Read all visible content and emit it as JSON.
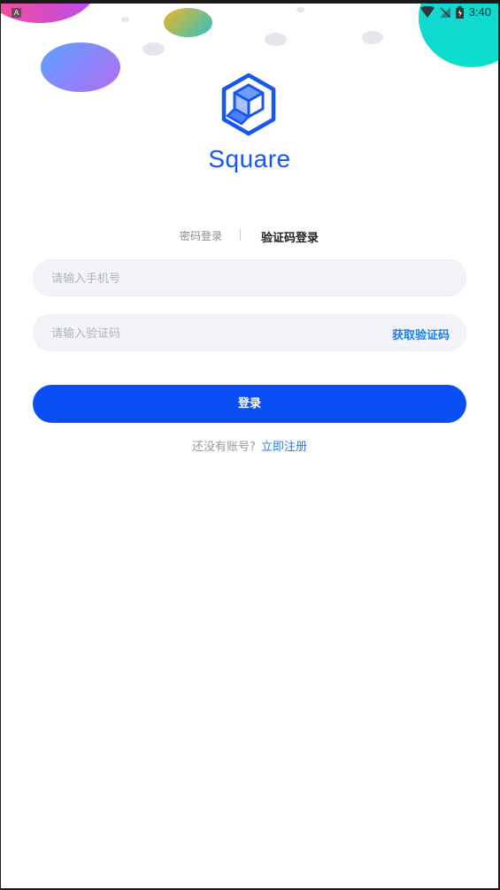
{
  "status_bar": {
    "time": "3:40",
    "app_icon_letter": "A",
    "icons": [
      "wifi-icon",
      "no-signal-icon",
      "battery-icon"
    ]
  },
  "app": {
    "brand_name": "Square",
    "brand_color": "#1657f0",
    "logo_icon": "cube-hexagon-icon"
  },
  "login_tabs": {
    "password_tab": "密码登录",
    "sms_tab": "验证码登录",
    "active": "sms_tab"
  },
  "form": {
    "phone_placeholder": "请输入手机号",
    "code_placeholder": "请输入验证码",
    "get_code_label": "获取验证码",
    "login_label": "登录",
    "primary_color": "#0a4ef6",
    "link_color": "#1e7ff2"
  },
  "register": {
    "question": "还没有账号?",
    "link": "立即注册"
  }
}
